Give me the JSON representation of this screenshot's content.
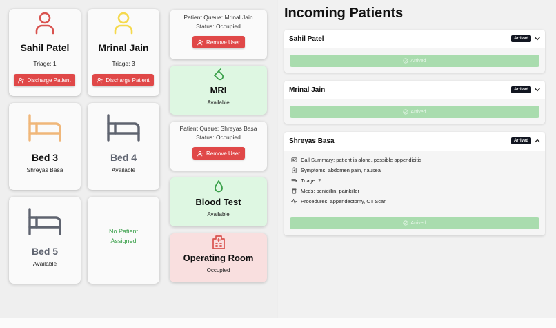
{
  "patients_cards": [
    {
      "name": "Sahil Patel",
      "triage": "Triage: 1",
      "button": "Discharge Patient",
      "icon_color": "#d9534f"
    },
    {
      "name": "Mrinal Jain",
      "triage": "Triage: 3",
      "button": "Discharge Patient",
      "icon_color": "#f5d94d"
    }
  ],
  "beds": [
    {
      "name": "Bed 3",
      "status": "Shreyas Basa",
      "icon_color": "#f0b77a"
    },
    {
      "name": "Bed 4",
      "status": "Available",
      "icon_color": "#5f6470"
    },
    {
      "name": "Bed 5",
      "status": "Available",
      "icon_color": "#5f6470"
    },
    {
      "empty_text_1": "No Patient",
      "empty_text_2": "Assigned"
    }
  ],
  "departments": {
    "queue1": {
      "line1": "Patient Queue: Mrinal Jain",
      "line2": "Status: Occupied",
      "button": "Remove User"
    },
    "mri": {
      "title": "MRI",
      "status": "Available"
    },
    "queue2": {
      "line1": "Patient Queue: Shreyas Basa",
      "line2": "Status: Occupied",
      "button": "Remove User"
    },
    "blood": {
      "title": "Blood Test",
      "status": "Available"
    },
    "or": {
      "title": "Operating Room",
      "status": "Occupied"
    }
  },
  "incoming": {
    "heading": "Incoming Patients",
    "items": [
      {
        "name": "Sahil Patel",
        "badge": "Arrived",
        "button": "Arrived"
      },
      {
        "name": "Mrinal Jain",
        "badge": "Arrived",
        "button": "Arrived"
      },
      {
        "name": "Shreyas Basa",
        "badge": "Arrived",
        "button": "Arrived",
        "details": {
          "summary": "Call Summary: patient is alone, possible appendicitis",
          "symptoms": "Symptoms: abdomen pain, nausea",
          "triage": "Triage: 2",
          "meds": "Meds: penicillin, painkiller",
          "procedures": "Procedures: appendectomy, CT Scan"
        }
      }
    ]
  },
  "colors": {
    "red": "#e04848",
    "green_bg": "#def7e2",
    "red_bg": "#f9dfdf",
    "badge": "#121621",
    "arrived": "#a9dcae"
  }
}
